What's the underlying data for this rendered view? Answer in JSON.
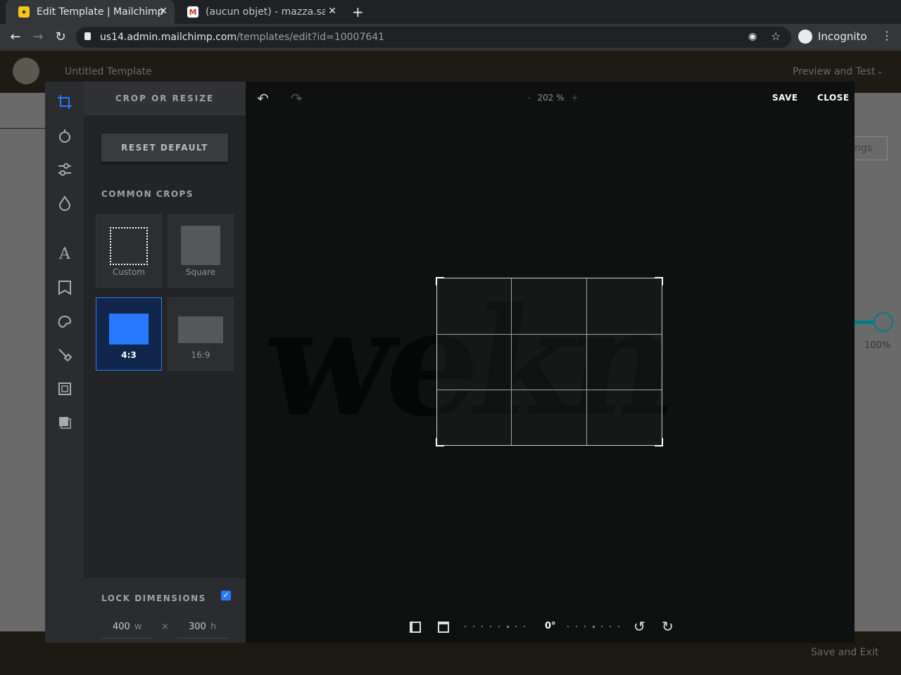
{
  "browser": {
    "tabs": [
      {
        "title": "Edit Template | Mailchimp",
        "active": true
      },
      {
        "title": "(aucun objet) - mazza.salm",
        "active": false
      }
    ],
    "new_tab_label": "+",
    "close_glyph": "✕",
    "url_host": "us14.admin.mailchimp.com",
    "url_path": "/templates/edit?id=10007641",
    "profile_label": "Incognito"
  },
  "mailchimp": {
    "template_title": "Untitled Template",
    "preview_label": "Preview and Test",
    "settings_fragment": "ngs",
    "slider_value": "100%",
    "save_exit_label": "Save and Exit"
  },
  "editor": {
    "panel_title": "CROP OR RESIZE",
    "reset_label": "RESET DEFAULT",
    "common_crops_label": "COMMON CROPS",
    "crops": [
      {
        "label": "Custom",
        "selected": false
      },
      {
        "label": "Square",
        "selected": false
      },
      {
        "label": "4:3",
        "selected": true
      },
      {
        "label": "16:9",
        "selected": false
      }
    ],
    "lock_label": "LOCK DIMENSIONS",
    "lock_checked": true,
    "width_value": "400",
    "width_unit": "w",
    "times_glyph": "×",
    "height_value": "300",
    "height_unit": "h",
    "zoom_minus": "-",
    "zoom_value": "202 %",
    "zoom_plus": "+",
    "save_label": "SAVE",
    "close_label": "CLOSE",
    "rotation_value": "0°",
    "accent_color": "#2979ff"
  },
  "icons": {
    "tools": [
      "crop-icon",
      "filter-icon",
      "adjust-icon",
      "focus-icon",
      "text-icon",
      "sticker-icon",
      "brush-icon",
      "draw-icon",
      "frame-icon",
      "overlay-icon"
    ]
  }
}
